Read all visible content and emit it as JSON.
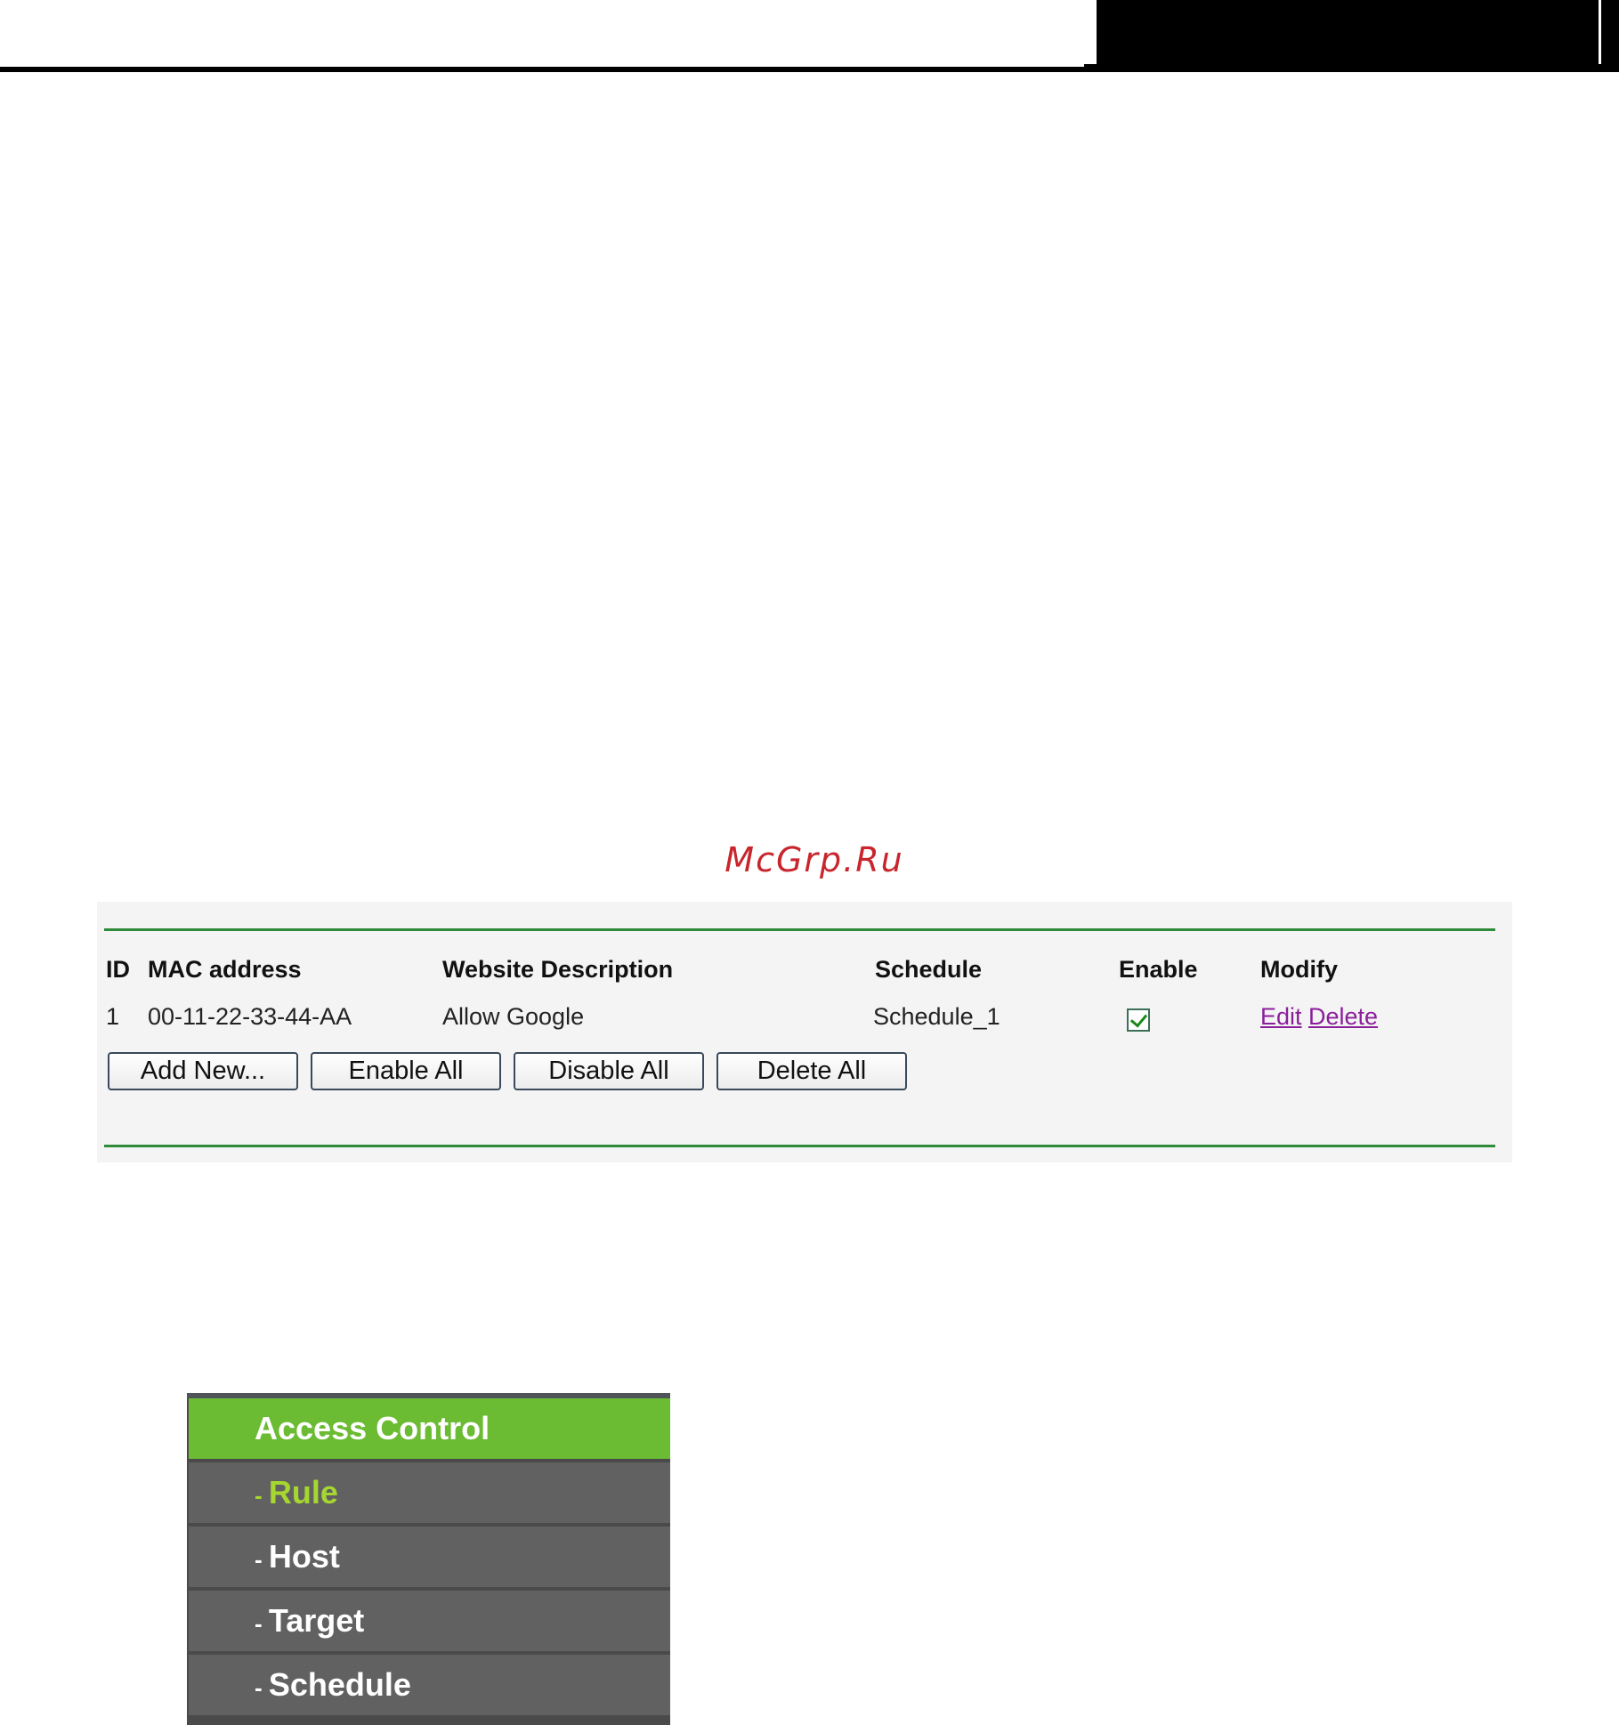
{
  "watermark": "McGrp.Ru",
  "table": {
    "headers": {
      "id": "ID",
      "mac": "MAC address",
      "desc": "Website Description",
      "schedule": "Schedule",
      "enable": "Enable",
      "modify": "Modify"
    },
    "rows": [
      {
        "id": "1",
        "mac": "00-11-22-33-44-AA",
        "desc": "Allow Google",
        "schedule": "Schedule_1",
        "enabled": true,
        "edit_label": "Edit",
        "delete_label": "Delete"
      }
    ]
  },
  "buttons": {
    "add_new": "Add New...",
    "enable_all": "Enable All",
    "disable_all": "Disable All",
    "delete_all": "Delete All"
  },
  "menu": {
    "header": "Access Control",
    "items": [
      {
        "dash": "- ",
        "label": "Rule",
        "active": true
      },
      {
        "dash": "- ",
        "label": "Host",
        "active": false
      },
      {
        "dash": "- ",
        "label": "Target",
        "active": false
      },
      {
        "dash": "- ",
        "label": "Schedule",
        "active": false
      }
    ]
  },
  "colors": {
    "menu_header": "#6bbb33",
    "menu_item": "#616161",
    "menu_active_text": "#a6d630",
    "rule_line": "#2f8a3a",
    "link": "#8a1f9a",
    "watermark": "#c8262d"
  }
}
